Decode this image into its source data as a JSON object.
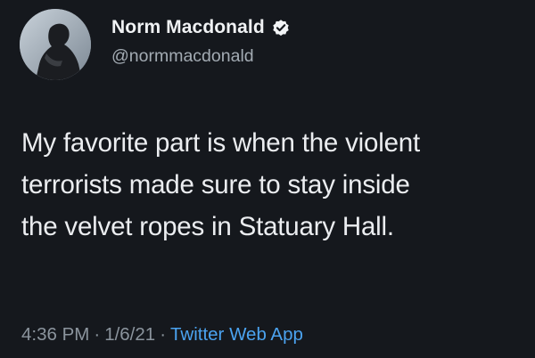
{
  "tweet": {
    "author": {
      "display_name": "Norm Macdonald",
      "handle": "@normmacdonald",
      "verified_icon": "verified-badge-icon",
      "avatar": "avatar-photo"
    },
    "text_lines": [
      "My favorite part is when the violent",
      "terrorists made sure to stay inside",
      "the velvet ropes in Statuary Hall."
    ],
    "meta": {
      "time": "4:36 PM",
      "separator": "·",
      "date": "1/6/21",
      "source": "Twitter Web App"
    }
  },
  "colors": {
    "background": "#15181d",
    "text": "#ebedf0",
    "muted": "#8b949d",
    "link": "#4ba3f0"
  }
}
